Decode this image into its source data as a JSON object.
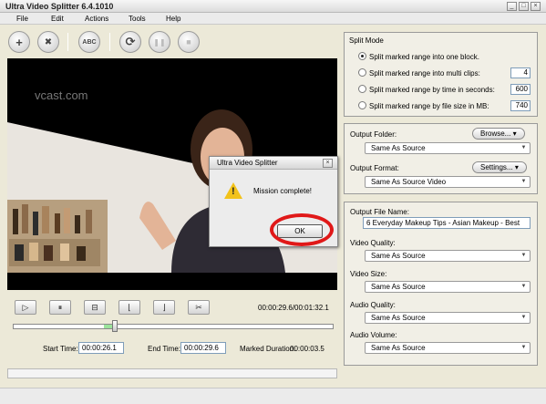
{
  "window": {
    "title": "Ultra Video Splitter 6.4.1010",
    "controls": [
      "_",
      "□",
      "×"
    ]
  },
  "menu": {
    "items": [
      "File",
      "Edit",
      "Actions",
      "Tools",
      "Help"
    ]
  },
  "toolbar": {
    "buttons": [
      {
        "icon": "+",
        "name": "add-icon"
      },
      {
        "icon": "✖",
        "name": "remove-icon"
      },
      {
        "icon": "ABC",
        "name": "abc-icon"
      },
      {
        "icon": "⟳",
        "name": "convert-icon"
      },
      {
        "icon": "❚❚",
        "name": "pause-icon"
      },
      {
        "icon": "■",
        "name": "stop-icon"
      }
    ]
  },
  "video": {
    "watermark": "vcast.com"
  },
  "playback": {
    "buttons": [
      {
        "icon": "▷",
        "name": "play-icon"
      },
      {
        "icon": "⏸",
        "name": "pause-icon"
      },
      {
        "icon": "⊟",
        "name": "frame-icon"
      },
      {
        "icon": "⌊",
        "name": "mark-start-icon"
      },
      {
        "icon": "⌋",
        "name": "mark-end-icon"
      },
      {
        "icon": "✂",
        "name": "scissors-icon"
      }
    ],
    "time": "00:00:29.6/00:01:32.1",
    "start_label": "Start Time:",
    "start_value": "00:00:26.1",
    "end_label": "End Time:",
    "end_value": "00:00:29.6",
    "duration_label": "Marked Duration:",
    "duration_value": "00:00:03.5",
    "marked_range": {
      "start": 0.283,
      "end": 0.321
    },
    "position": 0.321
  },
  "split_mode": {
    "title": "Split Mode",
    "options": [
      {
        "label": "Split  marked range into one block.",
        "value": "",
        "checked": true
      },
      {
        "label": "Split marked range into multi clips:",
        "value": "4",
        "checked": false
      },
      {
        "label": "Split marked range by time in seconds:",
        "value": "600",
        "checked": false
      },
      {
        "label": "Split marked range by file size in MB:",
        "value": "740",
        "checked": false
      }
    ]
  },
  "output": {
    "folder_label": "Output Folder:",
    "browse_label": "Browse...",
    "folder_value": "Same As Source",
    "format_label": "Output Format:",
    "settings_label": "Settings...",
    "format_value": "Same As Source Video"
  },
  "options": {
    "filename_label": "Output File Name:",
    "filename_value": "6 Everyday Makeup Tips - Asian Makeup - Best",
    "video_quality_label": "Video Quality:",
    "video_quality_value": "Same As Source",
    "video_size_label": "Video Size:",
    "video_size_value": "Same As Source",
    "audio_quality_label": "Audio Quality:",
    "audio_quality_value": "Same As Source",
    "audio_volume_label": "Audio Volume:",
    "audio_volume_value": "Same As Source"
  },
  "dialog": {
    "title": "Ultra Video Splitter",
    "message": "Mission complete!",
    "ok_label": "OK",
    "close": "×"
  },
  "colors": {
    "highlight": "#e01818",
    "accent_green": "#9be39b"
  }
}
